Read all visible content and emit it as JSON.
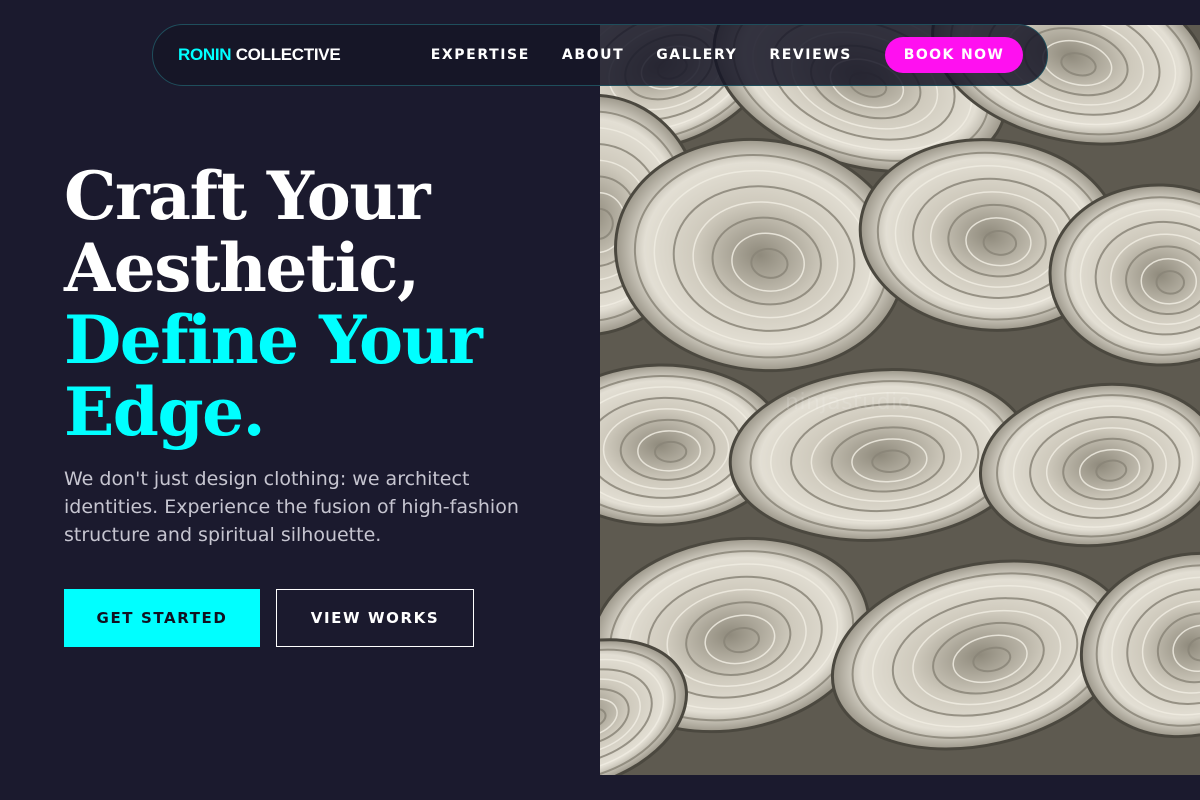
{
  "brand": {
    "name_accent": "RONIN",
    "name_rest": " COLLECTIVE"
  },
  "nav": {
    "links": [
      "EXPERTISE",
      "ABOUT",
      "GALLERY",
      "REVIEWS"
    ],
    "cta_label": "BOOK NOW"
  },
  "hero": {
    "title_lines": [
      "Craft Your",
      "Aesthetic,",
      "Define Your",
      "Edge."
    ],
    "subtitle": "We don't just design clothing: we architect identities. Experience the fusion of high-fashion structure and spiritual silhouette.",
    "primary_cta": "GET STARTED",
    "secondary_cta": "VIEW WORKS",
    "image_watermark": "ninjastudio",
    "image_subject": "stacked rolls of raw off-white fabric"
  },
  "colors": {
    "background": "#1b1a2e",
    "accent_cyan": "#00ffff",
    "accent_magenta": "#ff10f0",
    "text_white": "#ffffff",
    "text_muted": "#c6c5d0"
  },
  "icons": []
}
